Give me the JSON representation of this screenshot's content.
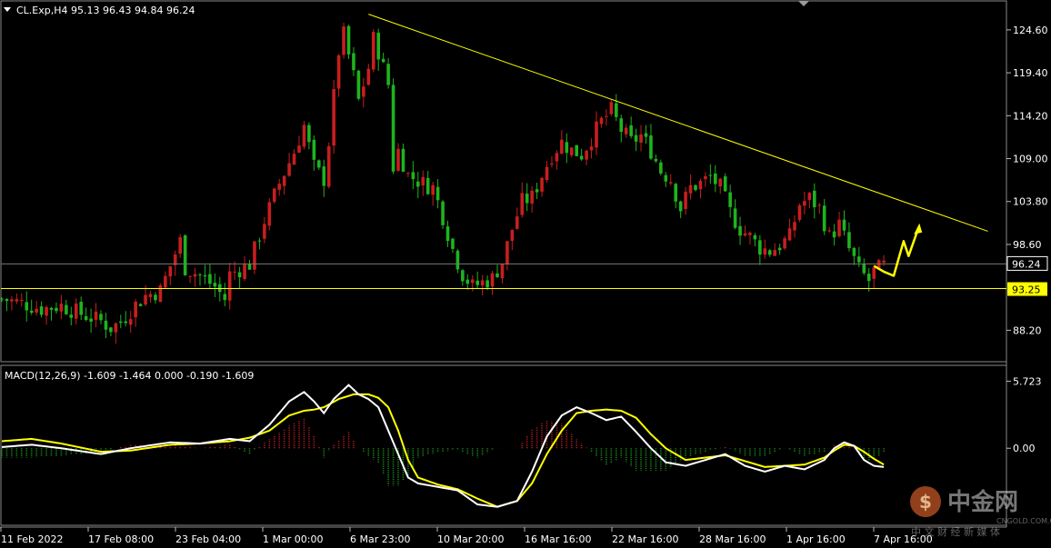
{
  "window": {
    "symbol_line": "CL.Exp,H4  95.13 96.43 94.84 96.24",
    "indicator_line": "MACD(12,26,9) -1.609 -1.464 0.000 -0.190 -1.609"
  },
  "watermark": {
    "brand": "中金网",
    "domain": "CNGOLD.COM.CN",
    "tagline": "中 文 财 经 新 媒 体"
  },
  "colors": {
    "background": "#000000",
    "bull_candle": "#c81e1e",
    "bear_candle": "#1eb41e",
    "trendline": "#ffff00",
    "macd_line": "#ffffff",
    "signal_line": "#ffff00",
    "hist_pos": "#b01c1c",
    "hist_neg": "#1a8a1a",
    "current_price_badge": "#ffffff",
    "support_badge": "#ffff00"
  },
  "chart_data": [
    {
      "type": "candlestick",
      "symbol": "CL.Exp",
      "timeframe": "H4",
      "last_ohlc": {
        "open": 95.13,
        "high": 96.43,
        "low": 94.84,
        "close": 96.24
      },
      "ylim": [
        84.5,
        128.0
      ],
      "y_ticks": [
        "124.60",
        "119.40",
        "114.20",
        "109.00",
        "103.80",
        "98.60",
        "88.20"
      ],
      "current_price": "96.24",
      "support_level": "93.25",
      "x_ticks": [
        "11 Feb 2022",
        "17 Feb 08:00",
        "23 Feb 04:00",
        "1 Mar 00:00",
        "6 Mar 23:00",
        "10 Mar 20:00",
        "16 Mar 16:00",
        "22 Mar 16:00",
        "28 Mar 16:00",
        "1 Apr 16:00",
        "7 Apr 16:00"
      ],
      "close_path": [
        [
          0,
          92.0
        ],
        [
          4,
          91.5
        ],
        [
          8,
          90.8
        ],
        [
          12,
          91.2
        ],
        [
          16,
          90.2
        ],
        [
          20,
          89.3
        ],
        [
          22,
          88.5
        ],
        [
          24,
          89.2
        ],
        [
          27,
          91.3
        ],
        [
          29,
          92.4
        ],
        [
          32,
          93.0
        ],
        [
          34,
          96.0
        ],
        [
          36,
          99.0
        ],
        [
          37,
          95.8
        ],
        [
          40,
          94.8
        ],
        [
          43,
          93.5
        ],
        [
          45,
          92.0
        ],
        [
          46,
          95.0
        ],
        [
          48,
          95.6
        ],
        [
          50,
          96.2
        ],
        [
          53,
          101.5
        ],
        [
          56,
          106.0
        ],
        [
          59,
          109.8
        ],
        [
          61,
          113.0
        ],
        [
          63,
          108.0
        ],
        [
          65,
          106.5
        ],
        [
          66,
          111.0
        ],
        [
          68,
          122.0
        ],
        [
          69,
          124.0
        ],
        [
          71,
          119.0
        ],
        [
          72,
          116.0
        ],
        [
          74,
          120.0
        ],
        [
          75,
          123.5
        ],
        [
          76,
          122.0
        ],
        [
          78,
          118.0
        ],
        [
          79,
          108.0
        ],
        [
          80,
          110.0
        ],
        [
          82,
          107.0
        ],
        [
          85,
          106.0
        ],
        [
          87,
          105.5
        ],
        [
          89,
          102.0
        ],
        [
          91,
          98.0
        ],
        [
          93,
          95.0
        ],
        [
          95,
          93.5
        ],
        [
          97,
          94.0
        ],
        [
          99,
          94.5
        ],
        [
          101,
          96.5
        ],
        [
          103,
          100.5
        ],
        [
          105,
          103.8
        ],
        [
          107,
          104.3
        ],
        [
          109,
          107.0
        ],
        [
          111,
          109.5
        ],
        [
          113,
          111.0
        ],
        [
          115,
          110.0
        ],
        [
          117,
          109.5
        ],
        [
          119,
          111.5
        ],
        [
          121,
          113.5
        ],
        [
          123,
          114.8
        ],
        [
          125,
          112.5
        ],
        [
          127,
          111.0
        ],
        [
          129,
          111.8
        ],
        [
          131,
          110.0
        ],
        [
          133,
          107.5
        ],
        [
          135,
          106.5
        ],
        [
          137,
          103.0
        ],
        [
          139,
          105.5
        ],
        [
          141,
          106.0
        ],
        [
          143,
          106.8
        ],
        [
          145,
          105.5
        ],
        [
          147,
          102.5
        ],
        [
          149,
          100.5
        ],
        [
          151,
          99.5
        ],
        [
          153,
          98.2
        ],
        [
          155,
          97.8
        ],
        [
          157,
          98.5
        ],
        [
          159,
          99.5
        ],
        [
          161,
          103.5
        ],
        [
          163,
          104.2
        ],
        [
          165,
          103.0
        ],
        [
          167,
          99.5
        ],
        [
          169,
          101.0
        ],
        [
          171,
          98.0
        ],
        [
          173,
          95.5
        ],
        [
          175,
          94.2
        ],
        [
          176,
          95.3
        ],
        [
          178,
          96.0
        ]
      ],
      "projection_arrow": [
        [
          176,
          96.0
        ],
        [
          178,
          95.3
        ],
        [
          180,
          94.8
        ],
        [
          182,
          99.0
        ],
        [
          183,
          97.2
        ],
        [
          185,
          100.6
        ]
      ],
      "trendline": {
        "from": [
          74,
          126.5
        ],
        "to": [
          199,
          100.2
        ]
      }
    },
    {
      "type": "macd",
      "name": "MACD(12,26,9)",
      "ylim": [
        -6.5,
        7.0
      ],
      "y_ticks": [
        "5.723",
        "0.00"
      ],
      "macd": [
        [
          0,
          0.1
        ],
        [
          6,
          0.3
        ],
        [
          12,
          0.0
        ],
        [
          20,
          -0.5
        ],
        [
          26,
          0.0
        ],
        [
          34,
          0.5
        ],
        [
          40,
          0.4
        ],
        [
          46,
          0.8
        ],
        [
          50,
          0.6
        ],
        [
          54,
          2.0
        ],
        [
          58,
          4.0
        ],
        [
          61,
          4.8
        ],
        [
          63,
          4.0
        ],
        [
          65,
          3.0
        ],
        [
          67,
          4.2
        ],
        [
          70,
          5.4
        ],
        [
          72,
          4.6
        ],
        [
          74,
          4.2
        ],
        [
          76,
          3.5
        ],
        [
          78,
          1.5
        ],
        [
          80,
          -0.5
        ],
        [
          82,
          -2.5
        ],
        [
          84,
          -3.0
        ],
        [
          88,
          -3.3
        ],
        [
          92,
          -3.6
        ],
        [
          96,
          -4.8
        ],
        [
          100,
          -5.0
        ],
        [
          104,
          -4.5
        ],
        [
          107,
          -2.0
        ],
        [
          110,
          1.0
        ],
        [
          113,
          2.8
        ],
        [
          116,
          3.5
        ],
        [
          119,
          3.0
        ],
        [
          122,
          2.4
        ],
        [
          125,
          2.7
        ],
        [
          128,
          1.4
        ],
        [
          131,
          0.0
        ],
        [
          134,
          -1.2
        ],
        [
          138,
          -1.5
        ],
        [
          142,
          -1.0
        ],
        [
          146,
          -0.5
        ],
        [
          150,
          -1.5
        ],
        [
          154,
          -2.0
        ],
        [
          158,
          -1.5
        ],
        [
          162,
          -1.8
        ],
        [
          166,
          -1.0
        ],
        [
          168,
          0.0
        ],
        [
          170,
          0.5
        ],
        [
          172,
          0.2
        ],
        [
          174,
          -1.0
        ],
        [
          176,
          -1.5
        ],
        [
          178,
          -1.6
        ]
      ],
      "signal": [
        [
          0,
          0.6
        ],
        [
          6,
          0.8
        ],
        [
          12,
          0.4
        ],
        [
          20,
          -0.3
        ],
        [
          26,
          -0.2
        ],
        [
          34,
          0.3
        ],
        [
          40,
          0.4
        ],
        [
          46,
          0.6
        ],
        [
          50,
          0.9
        ],
        [
          54,
          1.5
        ],
        [
          58,
          2.8
        ],
        [
          61,
          3.2
        ],
        [
          63,
          3.3
        ],
        [
          65,
          3.5
        ],
        [
          68,
          4.2
        ],
        [
          71,
          4.6
        ],
        [
          74,
          4.6
        ],
        [
          76,
          4.3
        ],
        [
          78,
          3.5
        ],
        [
          80,
          1.5
        ],
        [
          82,
          -1.0
        ],
        [
          84,
          -2.5
        ],
        [
          88,
          -3.1
        ],
        [
          92,
          -3.5
        ],
        [
          96,
          -4.3
        ],
        [
          100,
          -5.0
        ],
        [
          104,
          -4.5
        ],
        [
          107,
          -3.0
        ],
        [
          110,
          -0.5
        ],
        [
          113,
          1.5
        ],
        [
          116,
          3.0
        ],
        [
          119,
          3.2
        ],
        [
          122,
          3.3
        ],
        [
          125,
          3.2
        ],
        [
          128,
          2.6
        ],
        [
          131,
          1.2
        ],
        [
          134,
          0.0
        ],
        [
          138,
          -1.0
        ],
        [
          142,
          -0.8
        ],
        [
          146,
          -0.6
        ],
        [
          150,
          -1.1
        ],
        [
          154,
          -1.6
        ],
        [
          158,
          -1.5
        ],
        [
          162,
          -1.4
        ],
        [
          166,
          -0.8
        ],
        [
          168,
          -0.2
        ],
        [
          170,
          0.3
        ],
        [
          172,
          0.2
        ],
        [
          174,
          -0.3
        ],
        [
          176,
          -0.9
        ],
        [
          178,
          -1.4
        ]
      ]
    }
  ]
}
